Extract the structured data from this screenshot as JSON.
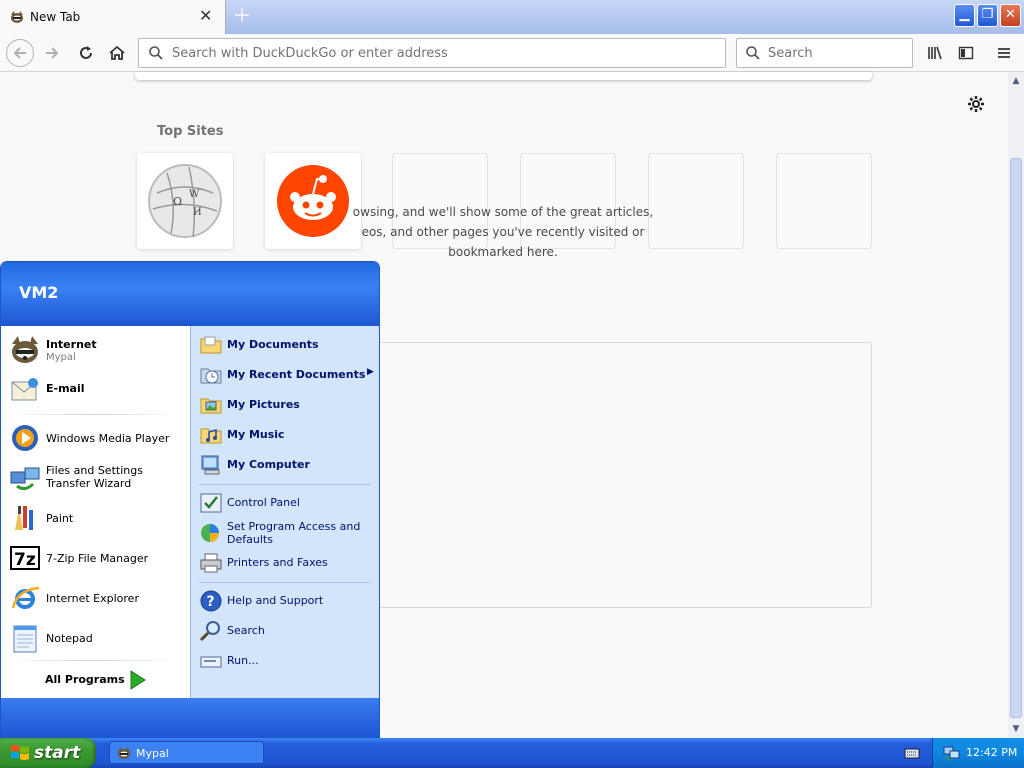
{
  "browser": {
    "tab_title": "New Tab",
    "url_placeholder": "Search with DuckDuckGo or enter address",
    "search_placeholder": "Search"
  },
  "content": {
    "top_sites_title": "Top Sites",
    "tiles": [
      "wikipedia",
      "reddit",
      "",
      "",
      "",
      ""
    ],
    "highlights_lines": [
      "owsing, and we'll show some of the great articles,",
      "eos, and other pages you've recently visited or",
      "bookmarked here."
    ]
  },
  "start_menu": {
    "user": "VM2",
    "left_items": [
      {
        "label": "Internet",
        "sub": "Mypal",
        "bold": true,
        "icon": "mypal-icon"
      },
      {
        "label": "E-mail",
        "sub": "",
        "bold": true,
        "icon": "email-icon"
      },
      {
        "label": "Windows Media Player",
        "icon": "media-player-icon"
      },
      {
        "label": "Files and Settings Transfer Wizard",
        "icon": "transfer-wizard-icon"
      },
      {
        "label": "Paint",
        "icon": "paint-icon"
      },
      {
        "label": "7-Zip File Manager",
        "icon": "7zip-icon"
      },
      {
        "label": "Internet Explorer",
        "icon": "ie-icon"
      },
      {
        "label": "Notepad",
        "icon": "notepad-icon"
      }
    ],
    "all_programs": "All Programs",
    "right_items": [
      {
        "label": "My Documents",
        "bold": true
      },
      {
        "label": "My Recent Documents",
        "bold": true
      },
      {
        "label": "My Pictures",
        "bold": true
      },
      {
        "label": "My Music",
        "bold": true
      },
      {
        "label": "My Computer",
        "bold": true
      },
      {
        "label": "Control Panel"
      },
      {
        "label": "Set Program Access and Defaults"
      },
      {
        "label": "Printers and Faxes"
      },
      {
        "label": "Help and Support"
      },
      {
        "label": "Search"
      },
      {
        "label": "Run..."
      }
    ]
  },
  "taskbar": {
    "start_label": "start",
    "task_label": "Mypal",
    "clock": "12:42 PM"
  }
}
